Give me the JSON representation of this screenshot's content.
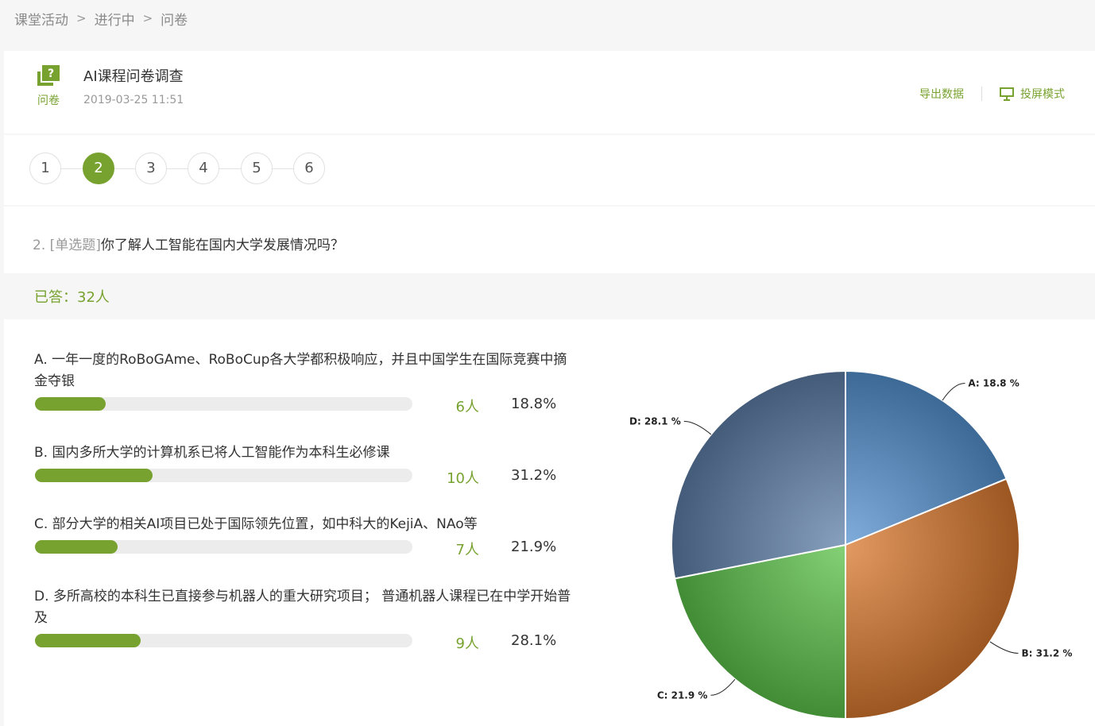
{
  "breadcrumb": {
    "items": [
      "课堂活动",
      "进行中",
      "问卷"
    ]
  },
  "activity": {
    "type_label": "问卷",
    "icon": "questionnaire-icon",
    "title": "AI课程问卷调查",
    "date": "2019-03-25 11:51"
  },
  "actions": {
    "export_label": "导出数据",
    "projection_label": "投屏模式",
    "projection_icon": "projector-icon"
  },
  "steps": {
    "items": [
      "1",
      "2",
      "3",
      "4",
      "5",
      "6"
    ],
    "active": "2"
  },
  "question": {
    "number": "2.",
    "type": "[单选题]",
    "text": "你了解人工智能在国内大学发展情况吗？"
  },
  "answered": {
    "text": "已答：32人"
  },
  "options": [
    {
      "text": "A. 一年一度的RoBoGAme、RoBoCup各大学都积极响应，并且中国学生在国际竞赛中摘金夺银",
      "count": "6人",
      "percent": "18.8%"
    },
    {
      "text": "B. 国内多所大学的计算机系已将人工智能作为本科生必修课",
      "count": "10人",
      "percent": "31.2%"
    },
    {
      "text": "C. 部分大学的相关AI项目已处于国际领先位置，如中科大的KejiA、NAo等",
      "count": "7人",
      "percent": "21.9%"
    },
    {
      "text": "D. 多所高校的本科生已直接参与机器人的重大研究项目； 普通机器人课程已在中学开始普及",
      "count": "9人",
      "percent": "28.1%"
    }
  ],
  "colors": {
    "accent": "#78a22f",
    "A": "#5592d0",
    "B": "#d9782e",
    "C": "#5cc24a",
    "D": "#5f80a8"
  },
  "chart_data": {
    "type": "pie",
    "categories": [
      "A",
      "B",
      "C",
      "D"
    ],
    "values": [
      18.8,
      31.2,
      21.9,
      28.1
    ],
    "labels": [
      "A: 18.8 %",
      "B: 31.2 %",
      "C: 21.9 %",
      "D: 28.1 %"
    ],
    "start": "top (12 o'clock), clockwise"
  }
}
